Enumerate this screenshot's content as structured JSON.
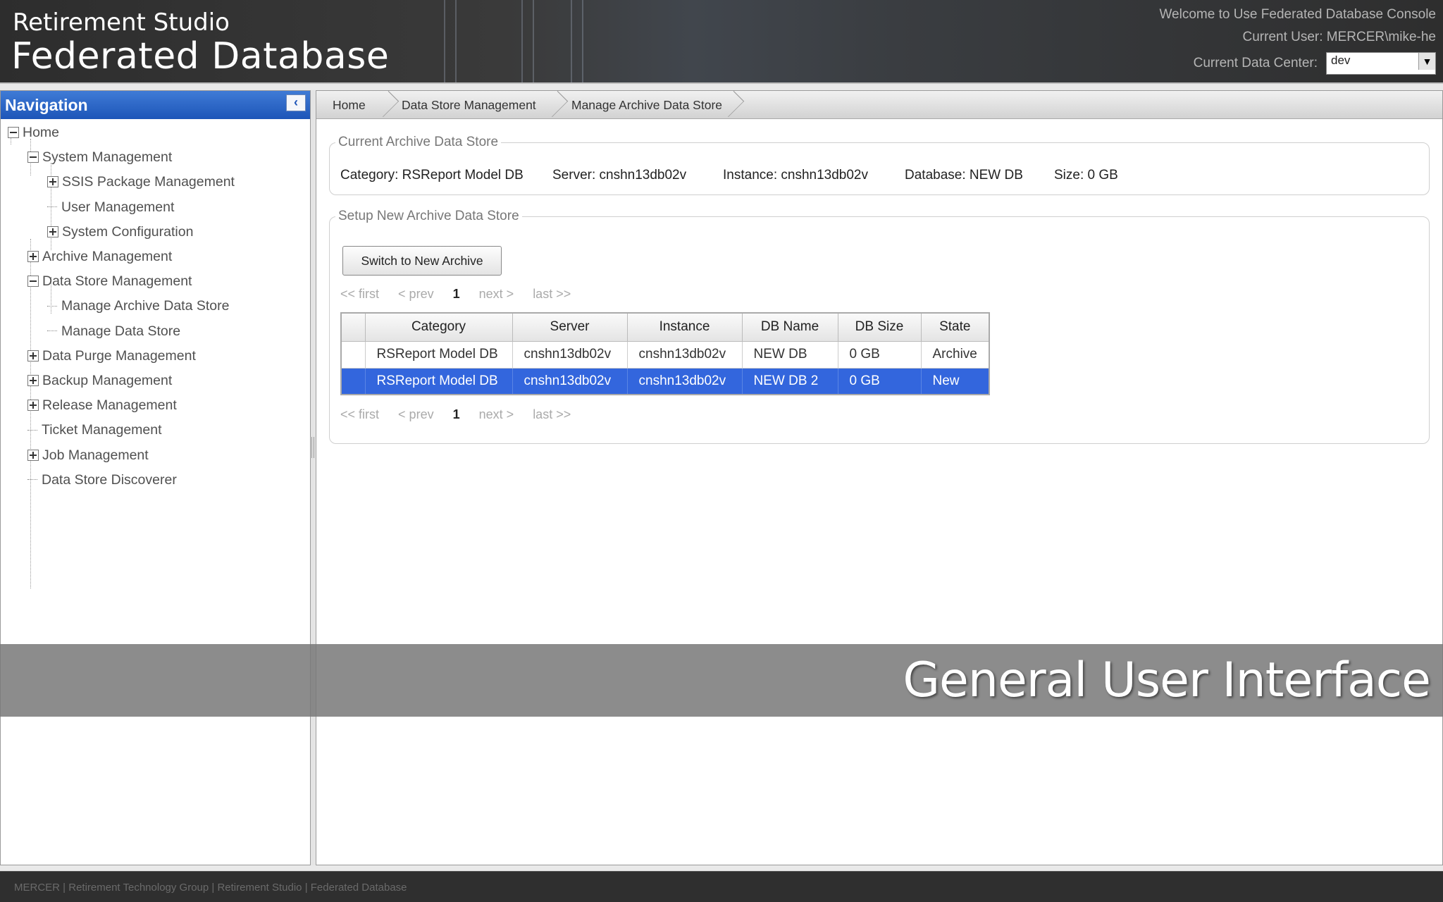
{
  "header": {
    "subtitle": "Retirement Studio",
    "title": "Federated Database",
    "welcome": "Welcome to Use Federated Database Console",
    "current_user": "Current User: MERCER\\mike-he",
    "data_center_label": "Current Data Center:",
    "data_center_value": "dev"
  },
  "nav": {
    "title": "Navigation",
    "collapse_icon": "chevron-left-icon",
    "items": [
      {
        "label": "Home",
        "level": 0,
        "state": "expanded"
      },
      {
        "label": "System Management",
        "level": 1,
        "state": "expanded"
      },
      {
        "label": "SSIS Package Management",
        "level": 2,
        "state": "collapsed"
      },
      {
        "label": "User Management",
        "level": 2,
        "state": "leaf"
      },
      {
        "label": "System Configuration",
        "level": 2,
        "state": "collapsed"
      },
      {
        "label": "Archive Management",
        "level": 1,
        "state": "collapsed"
      },
      {
        "label": "Data Store Management",
        "level": 1,
        "state": "expanded"
      },
      {
        "label": "Manage Archive Data Store",
        "level": 2,
        "state": "leaf"
      },
      {
        "label": "Manage Data Store",
        "level": 2,
        "state": "leaf"
      },
      {
        "label": "Data Purge Management",
        "level": 1,
        "state": "collapsed"
      },
      {
        "label": "Backup Management",
        "level": 1,
        "state": "collapsed"
      },
      {
        "label": "Release Management",
        "level": 1,
        "state": "collapsed"
      },
      {
        "label": "Ticket Management",
        "level": 1,
        "state": "leaf"
      },
      {
        "label": "Job Management",
        "level": 1,
        "state": "collapsed"
      },
      {
        "label": "Data Store Discoverer",
        "level": 1,
        "state": "leaf"
      }
    ]
  },
  "breadcrumb": [
    "Home",
    "Data Store Management",
    "Manage Archive Data Store"
  ],
  "current_archive": {
    "legend": "Current Archive Data Store",
    "category": "Category: RSReport Model DB",
    "server": "Server: cnshn13db02v",
    "instance": "Instance: cnshn13db02v",
    "database": "Database: NEW DB",
    "size": "Size: 0 GB"
  },
  "setup": {
    "legend": "Setup New Archive Data Store",
    "switch_button": "Switch to New Archive",
    "pager": {
      "first": "<< first",
      "prev": "< prev",
      "page": "1",
      "next": "next >",
      "last": "last >>"
    },
    "table": {
      "columns": [
        "Category",
        "Server",
        "Instance",
        "DB Name",
        "DB Size",
        "State"
      ],
      "rows": [
        [
          "RSReport Model DB",
          "cnshn13db02v",
          "cnshn13db02v",
          "NEW DB",
          "0 GB",
          "Archive"
        ],
        [
          "RSReport Model DB",
          "cnshn13db02v",
          "cnshn13db02v",
          "NEW DB 2",
          "0 GB",
          "New"
        ]
      ],
      "selected_row": 1
    }
  },
  "banner": "General User Interface",
  "footer": "MERCER | Retirement Technology Group | Retirement Studio | Federated Database",
  "colors": {
    "nav_header": "#1d55b8",
    "selected_row": "#3366dd"
  }
}
